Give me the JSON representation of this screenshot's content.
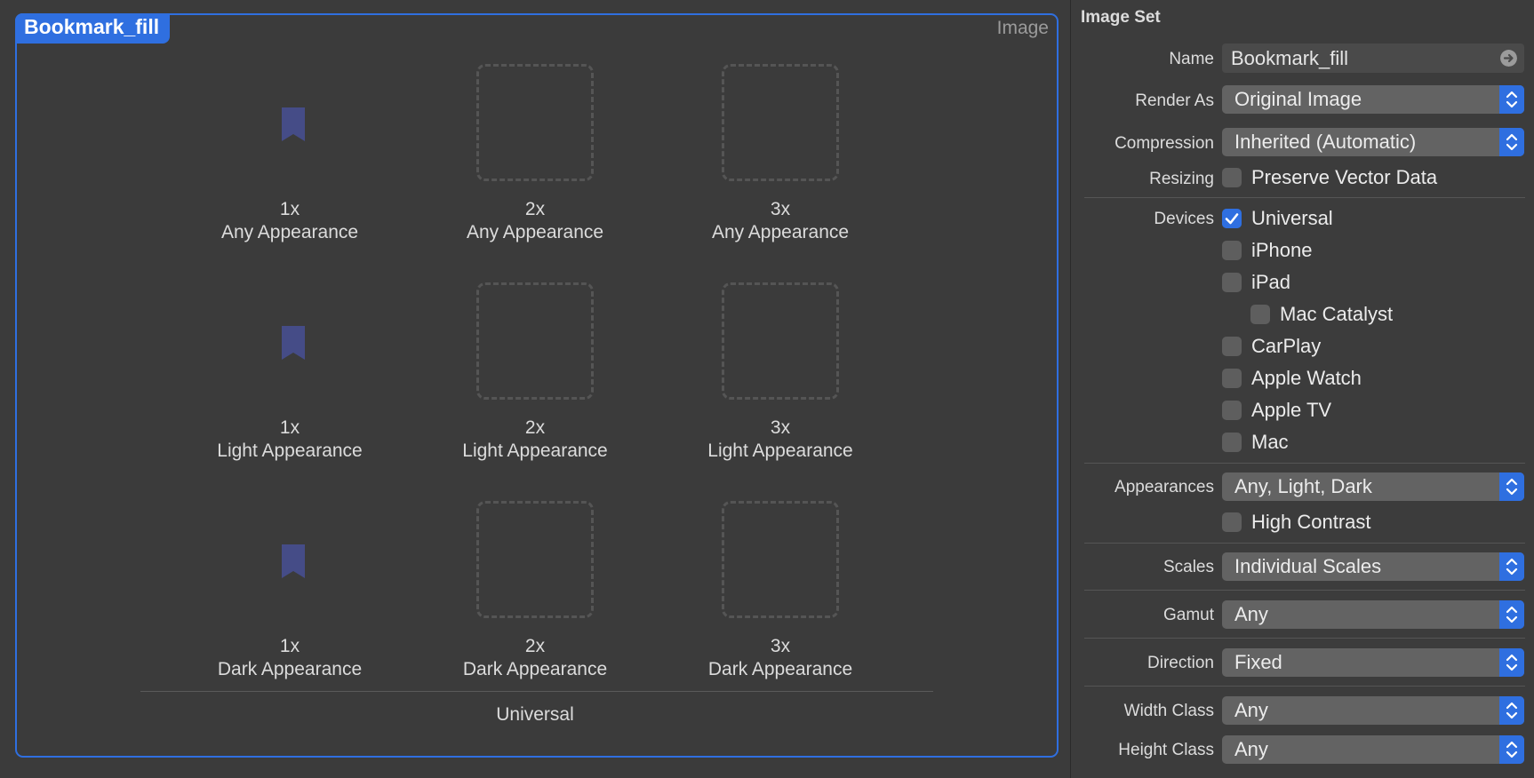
{
  "canvas": {
    "asset_name": "Bookmark_fill",
    "asset_type": "Image",
    "rows": [
      {
        "appearance": "Any Appearance",
        "cells": [
          {
            "scale": "1x",
            "filled": true
          },
          {
            "scale": "2x",
            "filled": false
          },
          {
            "scale": "3x",
            "filled": false
          }
        ]
      },
      {
        "appearance": "Light Appearance",
        "cells": [
          {
            "scale": "1x",
            "filled": true
          },
          {
            "scale": "2x",
            "filled": false
          },
          {
            "scale": "3x",
            "filled": false
          }
        ]
      },
      {
        "appearance": "Dark Appearance",
        "cells": [
          {
            "scale": "1x",
            "filled": true
          },
          {
            "scale": "2x",
            "filled": false
          },
          {
            "scale": "3x",
            "filled": false
          }
        ]
      }
    ],
    "group_label": "Universal",
    "bookmark_color": "#454c87"
  },
  "inspector": {
    "title": "Image Set",
    "name_label": "Name",
    "name_value": "Bookmark_fill",
    "render_as_label": "Render As",
    "render_as_value": "Original Image",
    "compression_label": "Compression",
    "compression_value": "Inherited (Automatic)",
    "resizing_label": "Resizing",
    "preserve_vector_label": "Preserve Vector Data",
    "preserve_vector_checked": false,
    "devices_label": "Devices",
    "devices": [
      {
        "label": "Universal",
        "checked": true
      },
      {
        "label": "iPhone",
        "checked": false
      },
      {
        "label": "iPad",
        "checked": false
      },
      {
        "label": "Mac Catalyst",
        "checked": false
      },
      {
        "label": "CarPlay",
        "checked": false
      },
      {
        "label": "Apple Watch",
        "checked": false
      },
      {
        "label": "Apple TV",
        "checked": false
      },
      {
        "label": "Mac",
        "checked": false
      }
    ],
    "appearances_label": "Appearances",
    "appearances_value": "Any, Light, Dark",
    "high_contrast_label": "High Contrast",
    "high_contrast_checked": false,
    "scales_label": "Scales",
    "scales_value": "Individual Scales",
    "gamut_label": "Gamut",
    "gamut_value": "Any",
    "direction_label": "Direction",
    "direction_value": "Fixed",
    "width_class_label": "Width Class",
    "width_class_value": "Any",
    "height_class_label": "Height Class",
    "height_class_value": "Any"
  },
  "colors": {
    "accent": "#2f6fe0"
  }
}
